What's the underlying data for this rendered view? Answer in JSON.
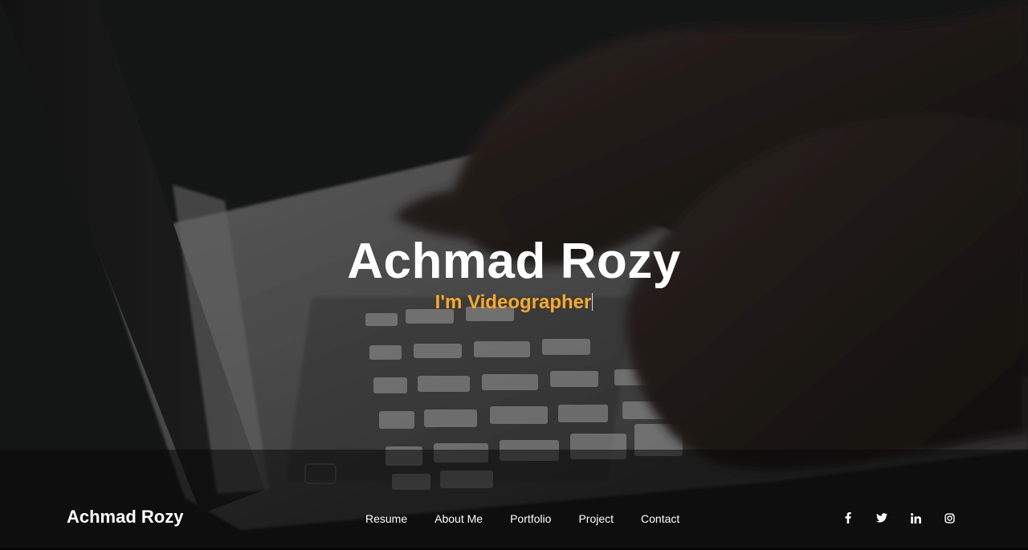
{
  "hero": {
    "name": "Achmad Rozy",
    "role_prefix": "I'm ",
    "role_typed": "Videographer"
  },
  "navbar": {
    "brand": "Achmad Rozy",
    "links": [
      {
        "label": "Resume"
      },
      {
        "label": "About Me"
      },
      {
        "label": "Portfolio"
      },
      {
        "label": "Project"
      },
      {
        "label": "Contact"
      }
    ],
    "social": [
      {
        "icon": "facebook-icon"
      },
      {
        "icon": "twitter-icon"
      },
      {
        "icon": "linkedin-icon"
      },
      {
        "icon": "instagram-icon"
      }
    ]
  },
  "colors": {
    "accent": "#f7a928",
    "text": "#ffffff",
    "background": "#141414"
  }
}
